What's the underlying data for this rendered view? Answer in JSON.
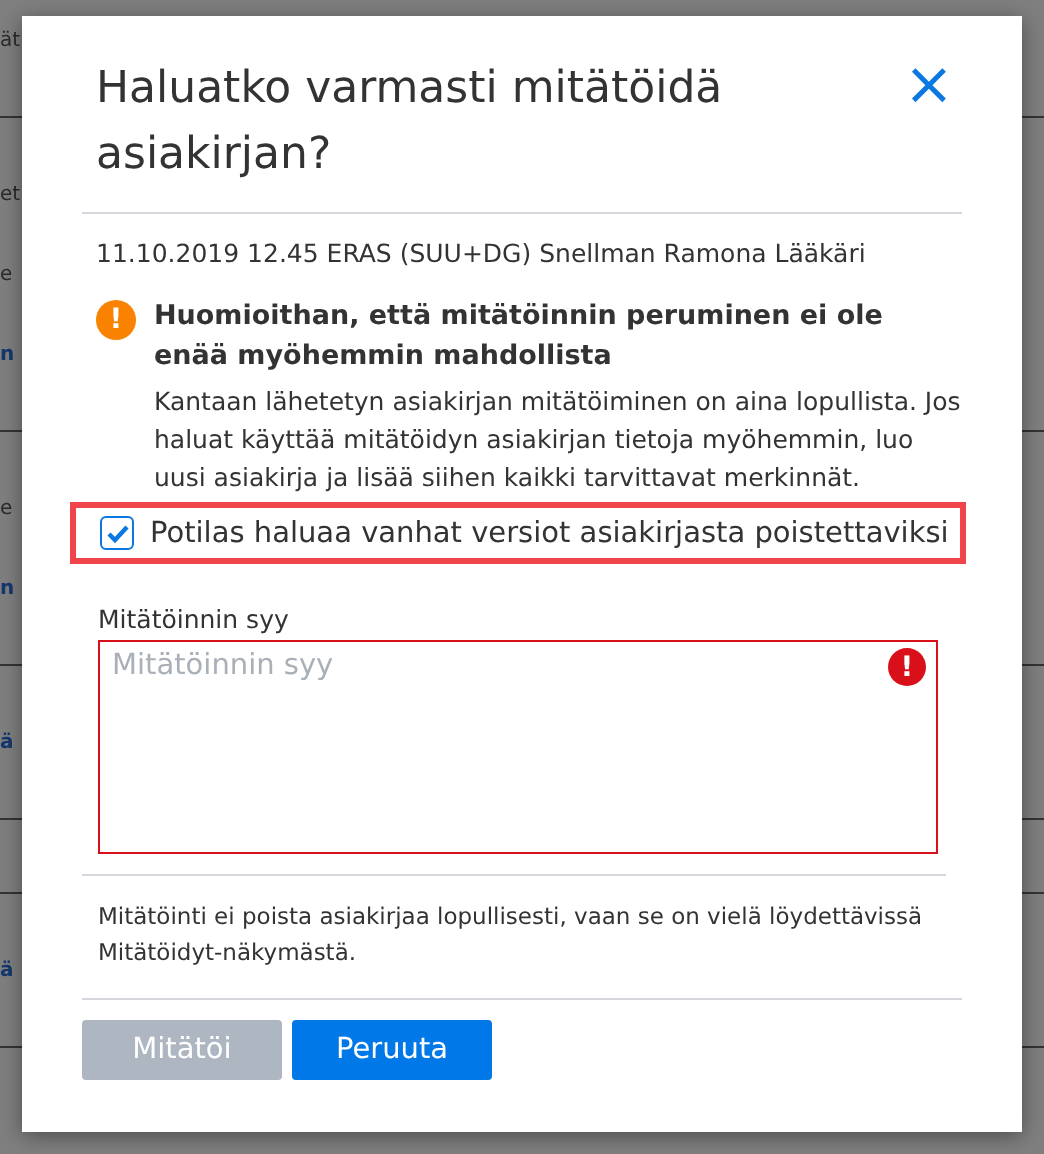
{
  "background": {
    "rows": [
      {
        "kind": "text",
        "text": "ät"
      },
      {
        "kind": "rule"
      },
      {
        "kind": "text",
        "text": "et"
      },
      {
        "kind": "text",
        "text": "e"
      },
      {
        "kind": "link",
        "text": "n"
      },
      {
        "kind": "rule"
      },
      {
        "kind": "text",
        "text": "e"
      },
      {
        "kind": "link",
        "text": "n"
      },
      {
        "kind": "rule"
      },
      {
        "kind": "link",
        "text": "ä"
      },
      {
        "kind": "rule"
      },
      {
        "kind": "rule"
      },
      {
        "kind": "link",
        "text": "ä"
      },
      {
        "kind": "rule"
      }
    ]
  },
  "dialog": {
    "title": "Haluatko varmasti mitätöidä asiakirjan?",
    "close": "×",
    "meta": "11.10.2019 12.45 ERAS (SUU+DG) Snellman Ramona Lääkäri",
    "warning": {
      "icon": "!",
      "title": "Huomioithan, että mitätöinnin peruminen ei ole enää myöhemmin mahdollista",
      "text": "Kantaan lähetetyn asiakirjan mitätöiminen on aina lopullista. Jos haluat käyttää mitätöidyn asiakirjan tietoja myöhemmin, luo uusi asiakirja ja lisää siihen kaikki tarvittavat merkinnät."
    },
    "checkbox": {
      "label": "Potilas haluaa vanhat versiot asiakirjasta poistettaviksi",
      "checked": true,
      "highlighted": true
    },
    "reason": {
      "label": "Mitätöinnin syy",
      "placeholder": "Mitätöinnin syy",
      "invalid": true,
      "error_icon": "!"
    },
    "note": "Mitätöinti ei poista asiakirjaa lopullisesti, vaan se on vielä löydettävissä Mitätöidyt-näkymästä.",
    "buttons": [
      {
        "label": "Mitätöi",
        "kind": "primary",
        "disabled": true
      },
      {
        "label": "Peruuta",
        "kind": "primary",
        "disabled": false
      }
    ]
  }
}
